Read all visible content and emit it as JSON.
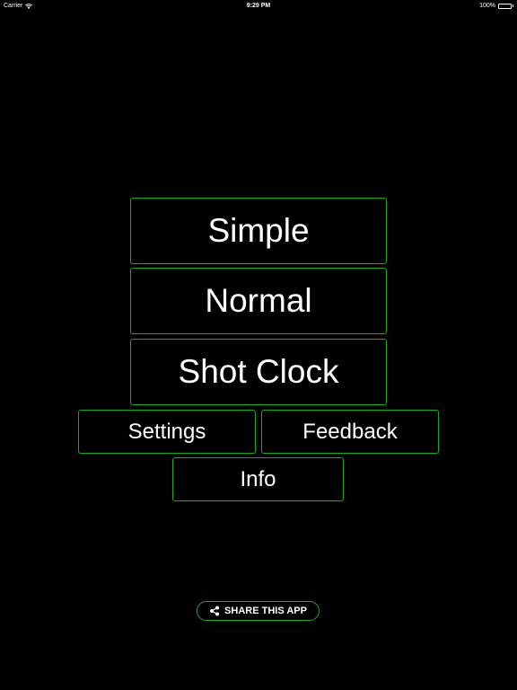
{
  "status_bar": {
    "carrier": "Carrier",
    "time": "9:29 PM",
    "battery": "100%",
    "wifi_icon": "wifi-icon",
    "battery_icon": "battery-icon"
  },
  "menu": {
    "simple_label": "Simple",
    "normal_label": "Normal",
    "shot_clock_label": "Shot Clock",
    "settings_label": "Settings",
    "feedback_label": "Feedback",
    "info_label": "Info"
  },
  "share": {
    "label": "SHARE THIS APP",
    "icon": "share-icon"
  },
  "colors": {
    "background": "#000000",
    "border": "#1fa61f",
    "text": "#ffffff"
  }
}
